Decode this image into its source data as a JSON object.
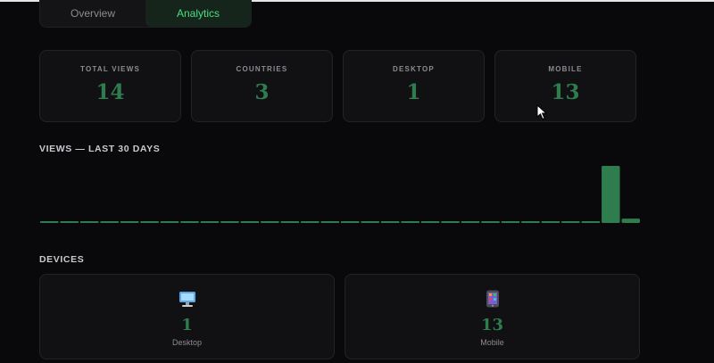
{
  "tabs": [
    {
      "label": "Overview",
      "active": false
    },
    {
      "label": "Analytics",
      "active": true
    }
  ],
  "stats": [
    {
      "label": "TOTAL VIEWS",
      "value": "14"
    },
    {
      "label": "COUNTRIES",
      "value": "3"
    },
    {
      "label": "DESKTOP",
      "value": "1"
    },
    {
      "label": "MOBILE",
      "value": "13"
    }
  ],
  "views_section": {
    "title": "VIEWS — LAST 30 DAYS"
  },
  "chart_data": {
    "type": "bar",
    "days": 30,
    "values": [
      0,
      0,
      0,
      0,
      0,
      0,
      0,
      0,
      0,
      0,
      0,
      0,
      0,
      0,
      0,
      0,
      0,
      0,
      0,
      0,
      0,
      0,
      0,
      0,
      0,
      0,
      0,
      0,
      13,
      1
    ],
    "ylim": [
      0,
      13
    ],
    "grid": false,
    "bar_color": "#2f7d4f"
  },
  "devices_section": {
    "title": "DEVICES"
  },
  "devices": [
    {
      "label": "Desktop",
      "value": "1",
      "icon": "desktop-computer-icon"
    },
    {
      "label": "Mobile",
      "value": "13",
      "icon": "mobile-phone-icon"
    }
  ],
  "colors": {
    "accent": "#2f7d4f",
    "active_tab_text": "#4ade80",
    "background": "#09090b",
    "card": "#111113"
  }
}
